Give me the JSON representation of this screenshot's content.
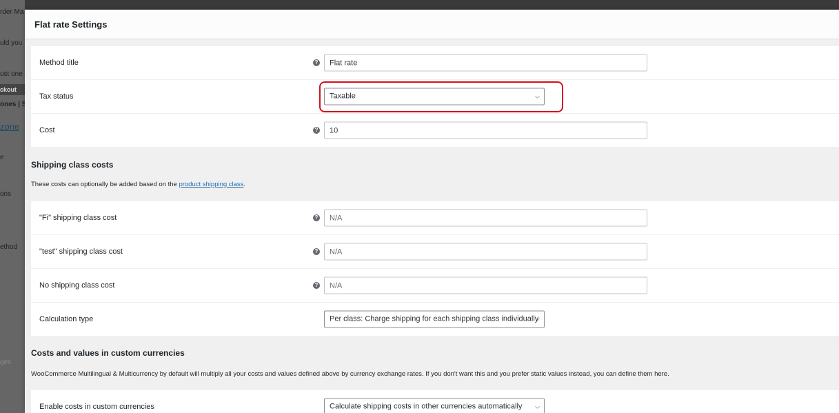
{
  "background": {
    "fragments": [
      "rder Ma",
      "uld you",
      "ust one",
      "ckout",
      "ones | S",
      "zone",
      "e",
      "ons",
      "ethod",
      "ges"
    ]
  },
  "modal": {
    "title": "Flat rate Settings"
  },
  "settings": {
    "method_title": {
      "label": "Method title",
      "value": "Flat rate"
    },
    "tax_status": {
      "label": "Tax status",
      "value": "Taxable"
    },
    "cost": {
      "label": "Cost",
      "value": "10"
    }
  },
  "shipping_class_costs": {
    "heading": "Shipping class costs",
    "description_before": "These costs can optionally be added based on the ",
    "description_link": "product shipping class",
    "description_after": ".",
    "rows": {
      "fi": {
        "label": "\"Fi\" shipping class cost",
        "placeholder": "N/A"
      },
      "test": {
        "label": "\"test\" shipping class cost",
        "placeholder": "N/A"
      },
      "none": {
        "label": "No shipping class cost",
        "placeholder": "N/A"
      },
      "calc": {
        "label": "Calculation type",
        "value": "Per class: Charge shipping for each shipping class individually"
      }
    }
  },
  "custom_currencies": {
    "heading": "Costs and values in custom currencies",
    "description": "WooCommerce Multilingual & Multicurrency by default will multiply all your costs and values defined above by currency exchange rates. If you don't want this and you prefer static values instead, you can define them here.",
    "enable": {
      "label": "Enable costs in custom currencies",
      "value": "Calculate shipping costs in other currencies automatically"
    }
  },
  "colors": {
    "highlight": "#d1111c",
    "link": "#2271b1"
  }
}
